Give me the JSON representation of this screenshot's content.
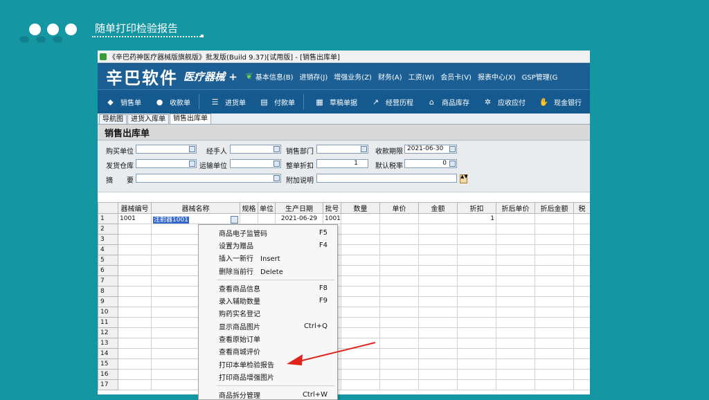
{
  "slide": {
    "title": "随单打印检验报告"
  },
  "app": {
    "title": "《辛巴药神医疗器械版旗舰版》批发版(Build 9.37)[试用版] - [销售出库单]",
    "brand": {
      "logo": "辛巴软件",
      "sub": "医疗器械 +"
    },
    "menu": [
      "基本信息(B)",
      "进销存(J)",
      "增强业务(Z)",
      "财务(A)",
      "工资(W)",
      "会员卡(V)",
      "报表中心(X)",
      "GSP管理(G"
    ],
    "toolbar": [
      {
        "label": "销售单",
        "icon": "tag-icon"
      },
      {
        "label": "收款单",
        "icon": "coins-icon"
      },
      {
        "label": "进货单",
        "icon": "list-icon"
      },
      {
        "label": "付款单",
        "icon": "payment-icon"
      },
      {
        "label": "草稿单据",
        "icon": "document-icon"
      },
      {
        "label": "经营历程",
        "icon": "chart-icon"
      },
      {
        "label": "商品库存",
        "icon": "warehouse-icon"
      },
      {
        "label": "应收应付",
        "icon": "gears-icon"
      },
      {
        "label": "现金银行",
        "icon": "bank-icon"
      }
    ],
    "tabs": [
      "导航图",
      "进货入库单",
      "销售出库单"
    ],
    "form": {
      "title": "销售出库单",
      "labels": {
        "buyer": "购买单位",
        "handler": "经手人",
        "dept": "销售部门",
        "due": "收款期限",
        "warehouse": "发货仓库",
        "transport": "运输单位",
        "discount": "整单折扣",
        "tax": "默认税率",
        "summary": "摘　　要",
        "note": "附加说明"
      },
      "values": {
        "due": "2021-06-30",
        "discount": "1",
        "tax": "0"
      }
    },
    "grid": {
      "headers": [
        "器械编号",
        "器械名称",
        "规格",
        "单位",
        "生产日期",
        "批号",
        "数量",
        "单价",
        "金额",
        "折扣",
        "折后单价",
        "折后金额",
        "税"
      ],
      "row1": {
        "code": "1001",
        "name": "注射器1001",
        "date": "2021-06-29",
        "batch": "1001",
        "discount": "1"
      },
      "row_numbers": [
        "1",
        "2",
        "3",
        "4",
        "5",
        "6",
        "7",
        "8",
        "9",
        "10",
        "11",
        "12",
        "13",
        "14",
        "15",
        "16",
        "17"
      ]
    },
    "context_menu": [
      {
        "label": "商品电子监管码",
        "shortcut": "F5"
      },
      {
        "label": "设置为赠品",
        "shortcut": "F4"
      },
      {
        "label": "插入一新行　Insert",
        "shortcut": ""
      },
      {
        "label": "删除当前行　Delete",
        "shortcut": ""
      },
      {
        "label": "查看商品信息",
        "shortcut": "F8"
      },
      {
        "label": "录入辅助数量",
        "shortcut": "F9"
      },
      {
        "label": "购药实名登记",
        "shortcut": ""
      },
      {
        "label": "显示商品图片",
        "shortcut": "Ctrl+Q"
      },
      {
        "label": "查看原始订单",
        "shortcut": ""
      },
      {
        "label": "查看商城评价",
        "shortcut": ""
      },
      {
        "label": "打印本单检验报告",
        "shortcut": ""
      },
      {
        "label": "打印商品增强图片",
        "shortcut": ""
      },
      {
        "label": "商品拆分管理",
        "shortcut": "Ctrl+W"
      }
    ],
    "colors": {
      "brand": "#1c5f94",
      "slide_bg": "#1597a3",
      "arrow": "#e0231c"
    }
  }
}
